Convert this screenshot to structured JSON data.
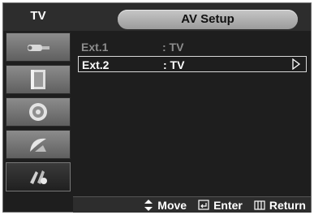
{
  "header": {
    "tv_label": "TV",
    "title": "AV Setup"
  },
  "sidebar": {
    "items": [
      {
        "icon": "antenna-input-icon"
      },
      {
        "icon": "picture-icon"
      },
      {
        "icon": "speaker-sound-icon"
      },
      {
        "icon": "channel-dish-icon"
      },
      {
        "icon": "setup-tools-icon"
      }
    ],
    "active_index": 4
  },
  "menu": {
    "rows": [
      {
        "label": "Ext.1",
        "value": ": TV",
        "state": "dimmed"
      },
      {
        "label": "Ext.2",
        "value": ": TV",
        "state": "selected"
      }
    ]
  },
  "footer": {
    "move_label": "Move",
    "enter_label": "Enter",
    "return_label": "Return"
  },
  "colors": {
    "background": "#1e1e1e",
    "title_bar": "#2d2d2d",
    "pill": "#b3b3b3",
    "dim_text": "#8d8d8d",
    "text": "#ffffff"
  }
}
